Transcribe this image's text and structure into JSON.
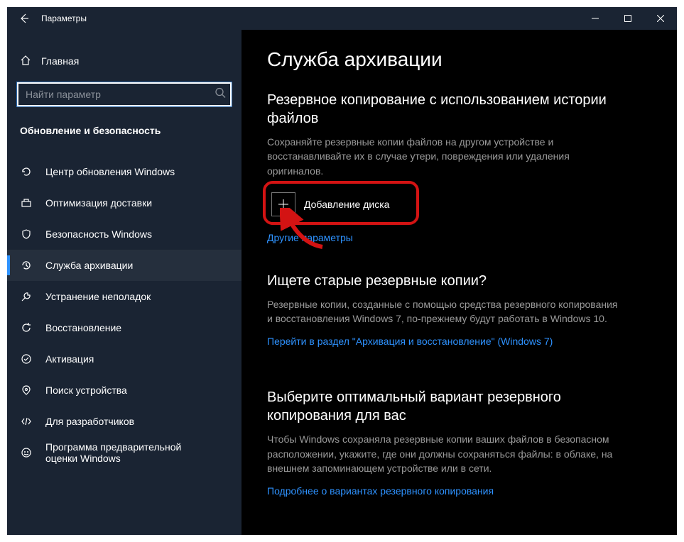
{
  "titlebar": {
    "title": "Параметры"
  },
  "sidebar": {
    "home": "Главная",
    "search_placeholder": "Найти параметр",
    "section": "Обновление и безопасность",
    "items": [
      {
        "label": "Центр обновления Windows",
        "icon": "refresh"
      },
      {
        "label": "Оптимизация доставки",
        "icon": "delivery"
      },
      {
        "label": "Безопасность Windows",
        "icon": "shield"
      },
      {
        "label": "Служба архивации",
        "icon": "backup",
        "active": true
      },
      {
        "label": "Устранение неполадок",
        "icon": "troubleshoot"
      },
      {
        "label": "Восстановление",
        "icon": "recovery"
      },
      {
        "label": "Активация",
        "icon": "activation"
      },
      {
        "label": "Поиск устройства",
        "icon": "find-device"
      },
      {
        "label": "Для разработчиков",
        "icon": "developers"
      },
      {
        "label": "Программа предварительной оценки Windows",
        "icon": "insider"
      }
    ]
  },
  "content": {
    "page_title": "Служба архивации",
    "section1": {
      "title": "Резервное копирование с использованием истории файлов",
      "body": "Сохраняйте резервные копии файлов на другом устройстве и восстанавливайте их в случае утери, повреждения или удаления оригиналов.",
      "add_disk_label": "Добавление диска",
      "more_link": "Другие параметры"
    },
    "section2": {
      "title": "Ищете старые резервные копии?",
      "body": "Резервные копии, созданные с помощью средства резервного копирования и восстановления Windows 7, по-прежнему будут работать в Windows 10.",
      "link": "Перейти в раздел \"Архивация и восстановление\" (Windows 7)"
    },
    "section3": {
      "title": "Выберите оптимальный вариант резервного копирования для вас",
      "body": "Чтобы Windows сохраняла резервные копии ваших файлов в безопасном расположении, укажите, где они должны сохраняться файлы: в облаке, на внешнем запоминающем устройстве или в сети.",
      "link": "Подробнее о вариантах резервного копирования"
    }
  }
}
